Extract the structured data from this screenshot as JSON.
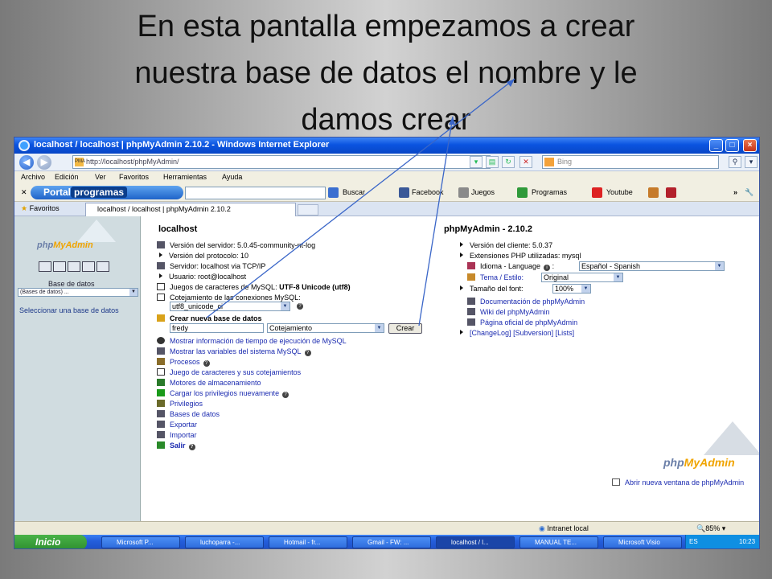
{
  "slide": {
    "title_lines": [
      "En esta pantalla  empezamos a crear",
      "nuestra base de datos el nombre y le",
      "damos crear"
    ]
  },
  "window": {
    "title": "localhost / localhost | phpMyAdmin 2.10.2 - Windows Internet Explorer",
    "url": "http://localhost/phpMyAdmin/",
    "search_placeholder": "Bing"
  },
  "menu": [
    "Archivo",
    "Edición",
    "Ver",
    "Favoritos",
    "Herramientas",
    "Ayuda"
  ],
  "toolbar": {
    "portal_part1": "Portal",
    "portal_part2": "programas",
    "items": [
      "Buscar",
      "Facebook",
      "Juegos",
      "Programas",
      "Youtube"
    ]
  },
  "tabs": {
    "favorites": "Favoritos",
    "active_tab": "localhost / localhost | phpMyAdmin 2.10.2"
  },
  "left": {
    "logo_php": "php",
    "logo_myadmin": "MyAdmin",
    "db_label": "Base de datos",
    "db_select": "(Bases de datos) ...",
    "select_prompt": "Seleccionar una base de datos"
  },
  "server": {
    "heading": "localhost",
    "info": [
      "Versión del servidor: 5.0.45-community-nt-log",
      "Versión del protocolo: 10",
      "Servidor: localhost via TCP/IP",
      "Usuario: root@localhost"
    ],
    "charset_label": "Juegos de caracteres de MySQL: ",
    "charset_value": "UTF-8 Unicode (utf8)",
    "collation_label": "Cotejamiento de las conexiones MySQL:",
    "collation_value": "utf8_unicode_ci",
    "create_db_label": "Crear nueva base de datos",
    "new_db_name": "fredy",
    "new_db_collation": "Cotejamiento",
    "create_button": "Crear",
    "links": [
      "Mostrar información de tiempo de ejecución de MySQL",
      "Mostrar las variables del sistema MySQL",
      "Procesos",
      "Juego de caracteres y sus cotejamientos",
      "Motores de almacenamiento",
      "Cargar los privilegios nuevamente",
      "Privilegios",
      "Bases de datos",
      "Exportar",
      "Importar",
      "Salir"
    ]
  },
  "pma": {
    "heading": "phpMyAdmin - 2.10.2",
    "client_version": "Versión del cliente: 5.0.37",
    "php_ext": "Extensiones PHP utilizadas: mysql",
    "language_label": "Idioma - Language",
    "language_value": "Español - Spanish",
    "theme_label": "Tema / Estilo:",
    "theme_value": "Original",
    "font_label": "Tamaño del font:",
    "font_value": "100%",
    "doc_links": [
      "Documentación de phpMyAdmin",
      "Wiki del phpMyAdmin",
      "Página oficial de phpMyAdmin"
    ],
    "changelog": "[ChangeLog]",
    "subversion": "[Subversion]",
    "lists": "[Lists]",
    "logo_php": "php",
    "logo_myadmin": "MyAdmin",
    "new_window": "Abrir nueva ventana de phpMyAdmin"
  },
  "status": {
    "zone": "Intranet local",
    "zoom": "85%"
  },
  "taskbar": {
    "start": "Inicio",
    "tasks": [
      "Microsoft P...",
      "luchoparra -...",
      "Hotmail - fr...",
      "Gmail - FW: ...",
      "localhost / l...",
      "MANUAL TE...",
      "Microsoft Visio"
    ],
    "lang": "ES",
    "time": "10:23"
  },
  "colors": {
    "annotation_line": "#3a66c8",
    "link": "#1b2bb0",
    "titlebar": "#0a54e0",
    "taskbar": "#245edb",
    "start": "#2f8f2f"
  }
}
